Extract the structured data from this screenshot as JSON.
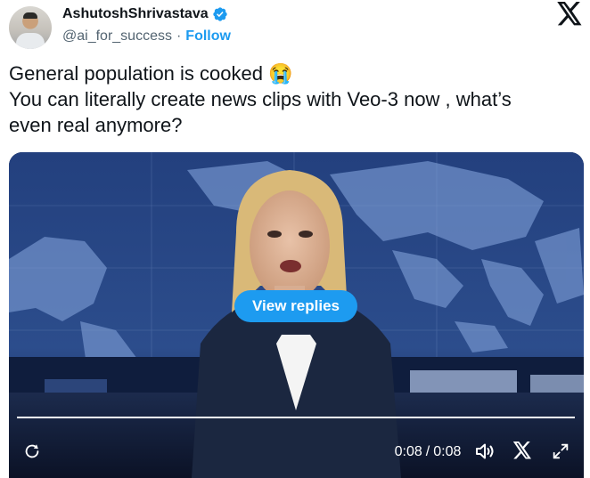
{
  "author": {
    "display_name": "AshutoshShrivastava",
    "handle": "@ai_for_success",
    "separator": "·",
    "follow_label": "Follow",
    "verified": true,
    "verified_color": "#1d9bf0"
  },
  "tweet": {
    "lines": [
      "General population is cooked 😭",
      "You can literally create news clips with Veo-3 now , what’s",
      "even real anymore?"
    ]
  },
  "video": {
    "view_replies_label": "View replies",
    "elapsed": "0:08",
    "time_separator": "/",
    "duration": "0:08",
    "progress": 1.0,
    "accent_color": "#1d9bf0"
  },
  "icons": {
    "brand": "x-logo-icon",
    "replay": "replay-icon",
    "volume": "volume-icon",
    "x_small": "x-logo-small-icon",
    "fullscreen": "fullscreen-icon",
    "verified": "verified-badge-icon"
  }
}
